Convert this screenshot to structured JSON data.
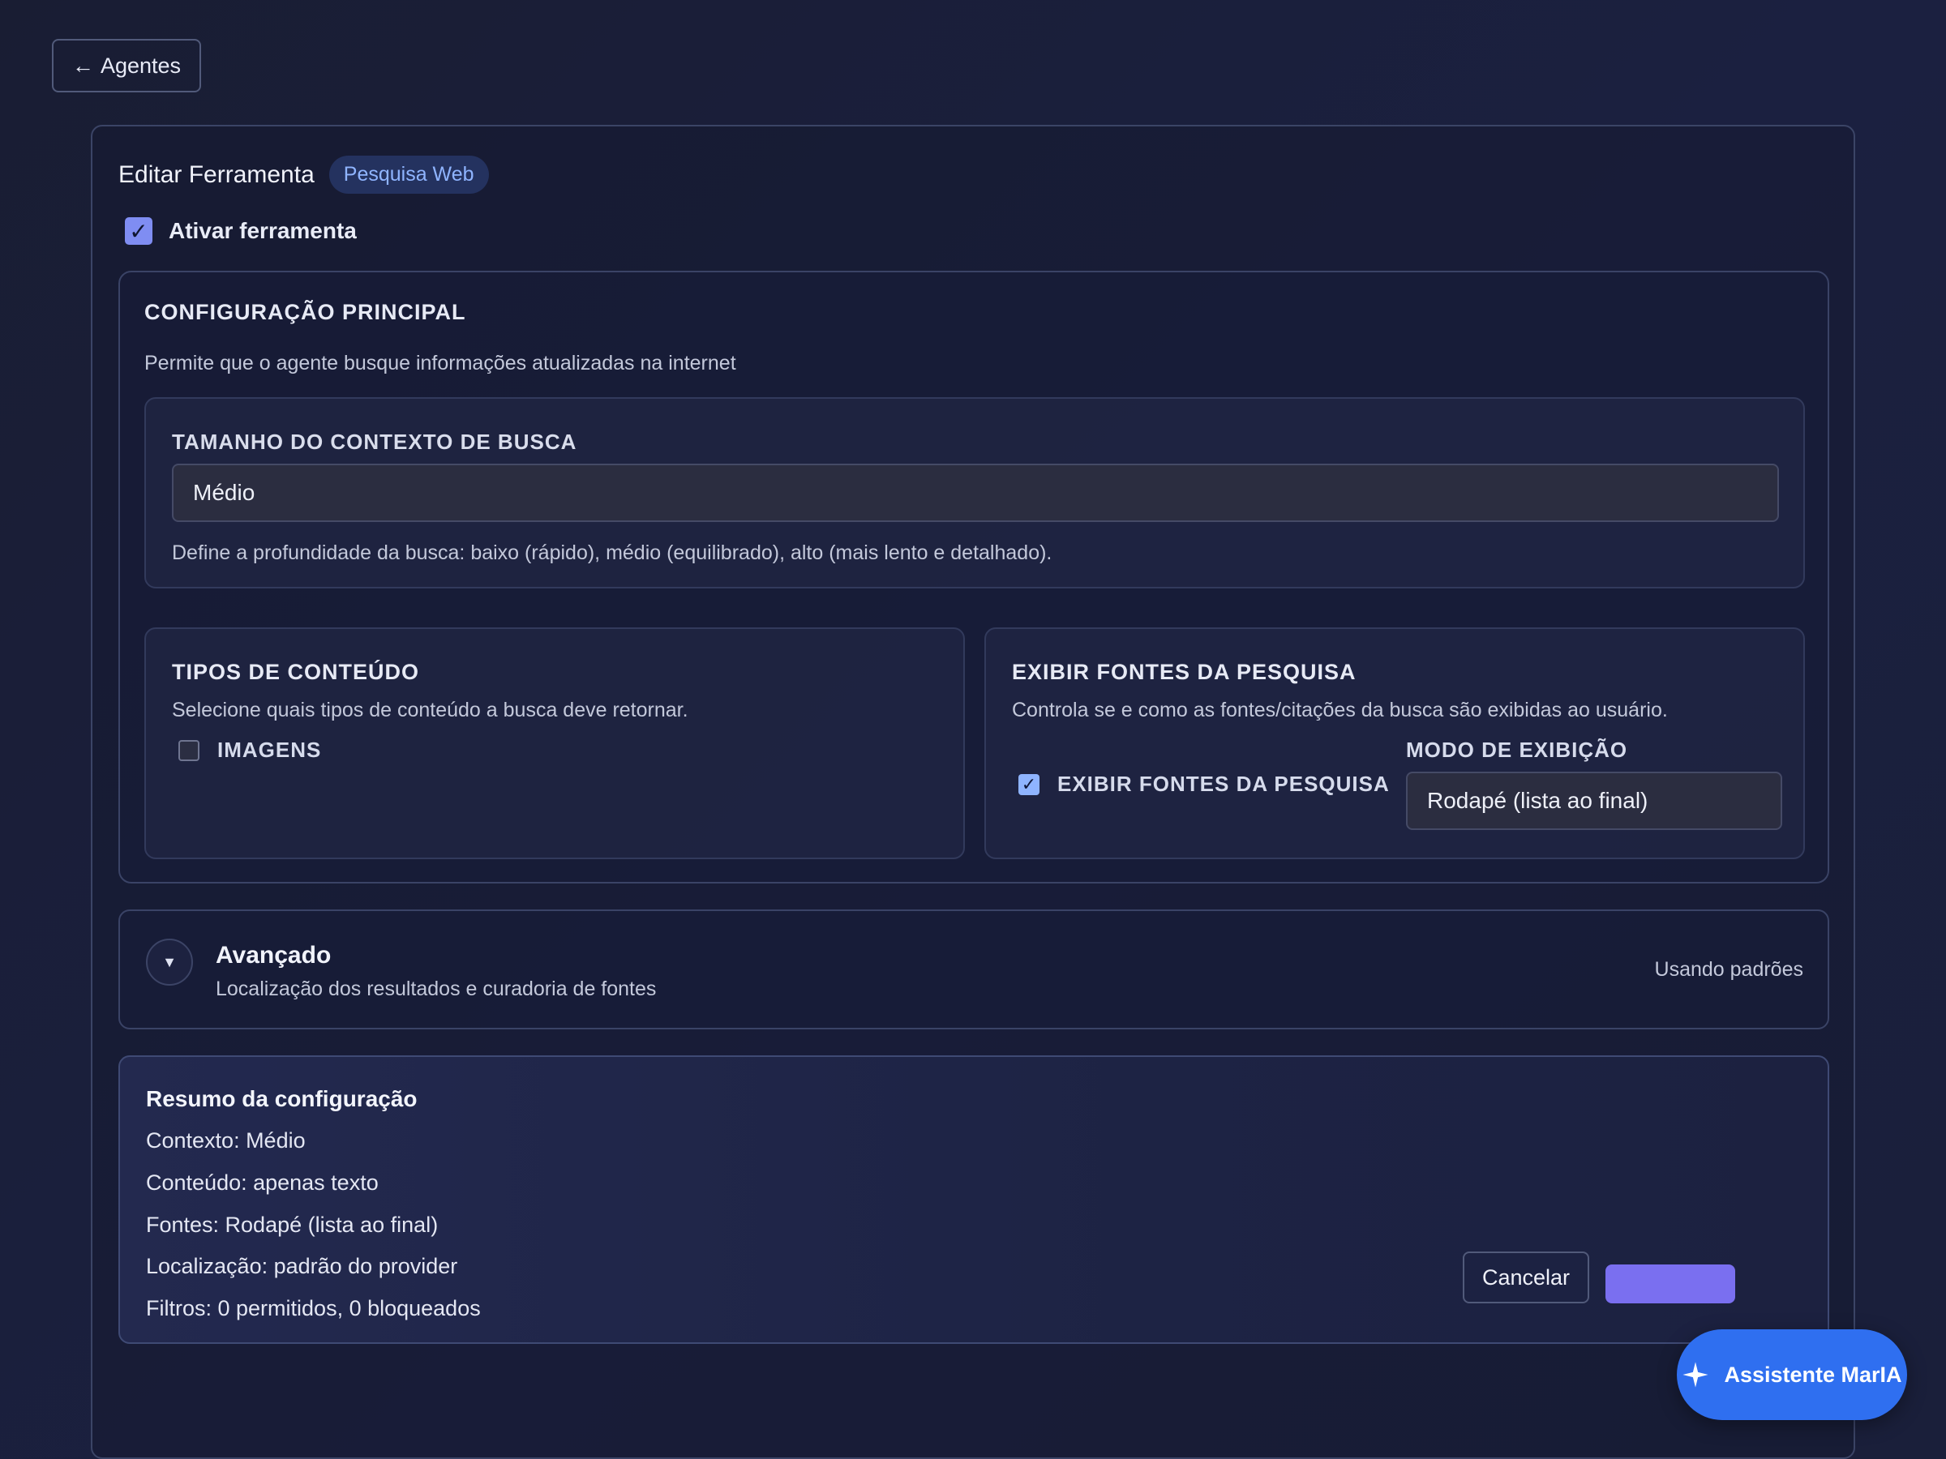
{
  "back": {
    "arrow": "←",
    "label": "Agentes"
  },
  "header": {
    "title": "Editar Ferramenta",
    "badge": "Pesquisa Web"
  },
  "enable": {
    "label": "Ativar ferramenta",
    "checked": true
  },
  "main": {
    "heading": "CONFIGURAÇÃO PRINCIPAL",
    "description": "Permite que o agente busque informações atualizadas na internet",
    "context": {
      "label": "TAMANHO DO CONTEXTO DE BUSCA",
      "value": "Médio",
      "help": "Define a profundidade da busca: baixo (rápido), médio (equilibrado), alto (mais lento e detalhado)."
    },
    "types": {
      "heading": "TIPOS DE CONTEÚDO",
      "description": "Selecione quais tipos de conteúdo a busca deve retornar.",
      "images_label": "IMAGENS",
      "images_checked": false
    },
    "sources": {
      "heading": "EXIBIR FONTES DA PESQUISA",
      "description": "Controla se e como as fontes/citações da busca são exibidas ao usuário.",
      "show_label": "EXIBIR FONTES DA PESQUISA",
      "show_checked": true,
      "mode_label": "MODO DE EXIBIÇÃO",
      "mode_value": "Rodapé (lista ao final)"
    }
  },
  "advanced": {
    "title": "Avançado",
    "subtitle": "Localização dos resultados e curadoria de fontes",
    "status": "Usando padrões"
  },
  "summary": {
    "title": "Resumo da configuração",
    "lines": [
      "Contexto: Médio",
      "Conteúdo: apenas texto",
      "Fontes: Rodapé (lista ao final)",
      "Localização: padrão do provider",
      "Filtros: 0 permitidos, 0 bloqueados"
    ]
  },
  "actions": {
    "cancel": "Cancelar"
  },
  "assistant": {
    "label": "Assistente MarIA",
    "icon": "sparkle-icon"
  },
  "colors": {
    "accent": "#7f8df2",
    "badge_text": "#8fb4ff",
    "fab": "#2f6ff0",
    "save": "#7a6ff0"
  }
}
